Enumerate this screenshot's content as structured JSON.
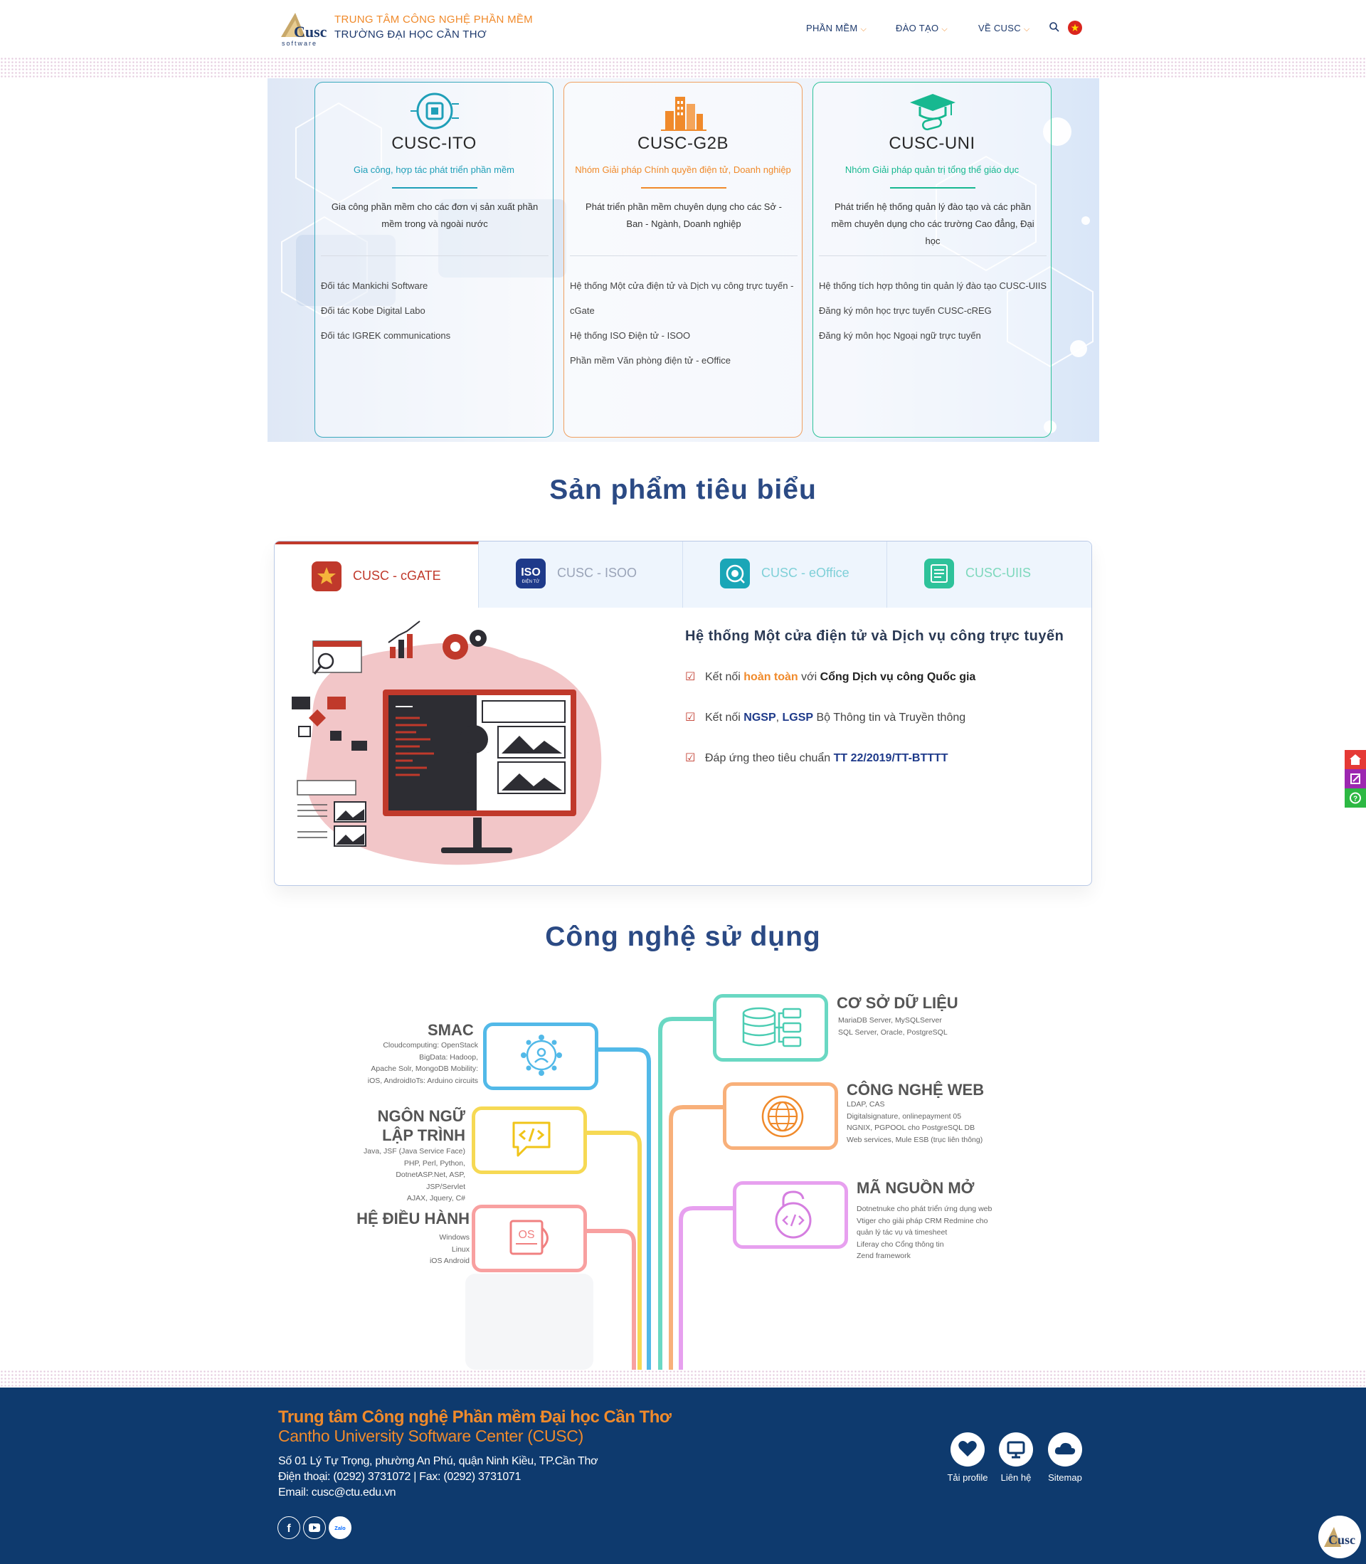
{
  "header": {
    "logo_text": "Cusc",
    "logo_sub": "software",
    "title_line1": "TRUNG TÂM CÔNG NGHỆ PHẦN MỀM",
    "title_line2": "TRƯỜNG ĐẠI HỌC CẦN THƠ",
    "nav": [
      {
        "label": "PHẦN MỀM"
      },
      {
        "label": "ĐÀO TẠO"
      },
      {
        "label": "VỀ CUSC"
      }
    ],
    "icons": [
      "search-icon",
      "vietnam-flag-icon"
    ]
  },
  "cards": [
    {
      "title": "CUSC-ITO",
      "subtitle": "Gia công, hợp tác phát triển phần mềm",
      "description": "Gia công phần mềm cho các đơn vị sản xuất phần mềm trong và ngoài nước",
      "items": [
        "Đối tác Mankichi Software",
        "Đối tác Kobe Digital Labo",
        "Đối tác IGREK communications"
      ],
      "accent": "#1f9fb8"
    },
    {
      "title": "CUSC-G2B",
      "subtitle": "Nhóm Giải pháp Chính quyền điện tử, Doanh nghiệp",
      "description": "Phát triển phần mềm chuyên dụng cho các Sở - Ban - Ngành, Doanh nghiệp",
      "items": [
        "Hệ thống Một cửa điện tử và Dịch vụ công trực tuyến -",
        "cGate",
        "Hệ thống ISO Điện tử - ISOO",
        "Phần mềm Văn phòng điện tử - eOffice"
      ],
      "accent": "#f08a2b"
    },
    {
      "title": "CUSC-UNI",
      "subtitle": "Nhóm Giải pháp quản trị tổng thể giáo dục",
      "description": "Phát triển hệ thống quản lý đào tạo và các phần mềm chuyên dụng cho các trường Cao đẳng, Đại học",
      "items": [
        "Hệ thống tích hợp thông tin quản lý đào tạo CUSC-UIIS",
        "Đăng ký môn học trực tuyến CUSC-cREG",
        "Đăng ký môn học Ngoại ngữ trực tuyến"
      ],
      "accent": "#17b890"
    }
  ],
  "products": {
    "section_title": "Sản phẩm tiêu biểu",
    "tabs": [
      {
        "label": "CUSC - cGATE",
        "active": true
      },
      {
        "label": "CUSC - ISOO",
        "active": false,
        "icon_text": "ISO",
        "icon_sub": "ĐIỆN TỬ"
      },
      {
        "label": "CUSC - eOffice",
        "active": false
      },
      {
        "label": "CUSC-UIIS",
        "active": false
      }
    ],
    "active_title": "Hệ thống Một cửa điện tử và Dịch vụ công trực tuyến",
    "features": [
      {
        "pre": "Kết nối ",
        "hl1": "hoàn toàn",
        "mid": " với ",
        "hl2": "Cổng Dịch vụ công Quốc gia",
        "post": ""
      },
      {
        "pre": "Kết nối ",
        "hl1": "NGSP",
        "mid": ", ",
        "hl2": "LGSP",
        "post": " Bộ Thông tin và Truyền thông"
      },
      {
        "pre": "Đáp ứng theo tiêu chuẩn ",
        "hl1": "TT 22/2019/TT-BTTTT",
        "mid": "",
        "hl2": "",
        "post": ""
      }
    ]
  },
  "tech": {
    "section_title": "Công nghệ sử dụng",
    "smac": {
      "title": "SMAC",
      "lines": [
        "Cloudcomputing: OpenStack",
        "BigData: Hadoop,",
        "Apache Solr, MongoDB Mobility:",
        "iOS, AndroidIoTs: Arduino circuits"
      ]
    },
    "lang": {
      "title1": "NGÔN NGỮ",
      "title2": "LẬP TRÌNH",
      "lines": [
        "Java, JSF (Java Service Face)",
        "PHP, Perl, Python,",
        "DotnetASP.Net, ASP,",
        "JSP/Servlet",
        "AJAX, Jquery, C#"
      ]
    },
    "os": {
      "title": "HỆ ĐIỀU HÀNH",
      "lines": [
        "Windows",
        "Linux",
        "iOS Android"
      ],
      "icon_text": "OS"
    },
    "db": {
      "title": "CƠ SỞ DỮ LIỆU",
      "lines": [
        "MariaDB Server, MySQLServer",
        "SQL Server, Oracle, PostgreSQL"
      ]
    },
    "web": {
      "title": "CÔNG NGHỆ WEB",
      "lines": [
        "LDAP, CAS",
        "Digitalsignature, onlinepayment 05",
        "NGNIX, PGPOOL cho PostgreSQL DB",
        "Web services, Mule ESB (trục liên thông)"
      ]
    },
    "oss": {
      "title": "MÃ NGUỒN MỞ",
      "lines": [
        "Dotnetnuke cho phát triển ứng dụng web",
        " Vtiger cho giải pháp CRM  Redmine cho",
        "quản lý tác vụ và timesheet",
        "Liferay cho Cổng thông tin",
        "Zend framework"
      ]
    }
  },
  "footer": {
    "title": "Trung tâm Công nghệ Phần mềm Đại học Cần Thơ",
    "title_en": "Cantho University Software Center (CUSC)",
    "address": "Số 01 Lý Tự Trọng, phường An Phú, quận Ninh Kiều, TP.Cần Thơ",
    "phone": "Điện thoại: (0292) 3731072 | Fax: (0292) 3731071",
    "email": "Email: cusc@ctu.edu.vn",
    "buttons": [
      {
        "label": "Tải profile"
      },
      {
        "label": "Liên hệ"
      },
      {
        "label": "Sitemap"
      }
    ],
    "social_zalo": "Zalo",
    "badge_text": "Cusc"
  },
  "colors": {
    "primary": "#2b4a84",
    "accent": "#f08a2b",
    "footer_bg": "#0e3a6e",
    "active_tab": "#c0392b"
  }
}
